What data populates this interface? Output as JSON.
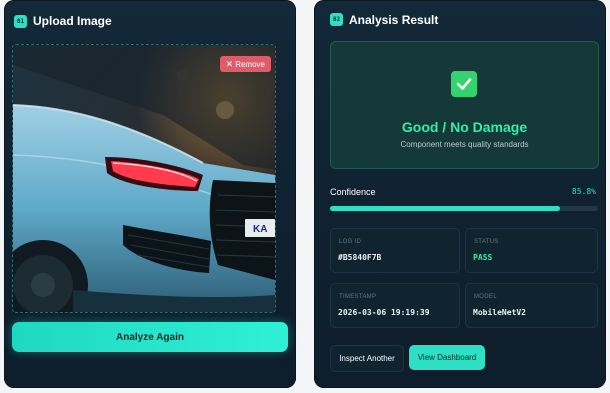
{
  "upload": {
    "step": "01",
    "title": "Upload Image",
    "remove_label": "Remove",
    "analyze_label": "Analyze Again"
  },
  "analysis": {
    "step": "02",
    "title": "Analysis Result",
    "verdict": "Good / No Damage",
    "verdict_sub": "Component meets quality standards",
    "confidence_label": "Confidence",
    "confidence_text": "85.8%",
    "confidence_fraction": 0.858,
    "fields": [
      {
        "label": "LOG ID",
        "value": "#B5840F7B"
      },
      {
        "label": "STATUS",
        "value": "PASS"
      },
      {
        "label": "TIMESTAMP",
        "value": "2026-03-06 19:19:39"
      },
      {
        "label": "MODEL",
        "value": "MobileNetV2"
      }
    ],
    "inspect_label": "Inspect Another",
    "dashboard_label": "View Dashboard"
  },
  "colors": {
    "accent": "#2de0c4",
    "pass": "#2ff0a8",
    "remove": "#e05b6a",
    "check": "#35d36e"
  },
  "icons": {
    "verdict": "check-square-icon",
    "remove": "x-icon"
  }
}
